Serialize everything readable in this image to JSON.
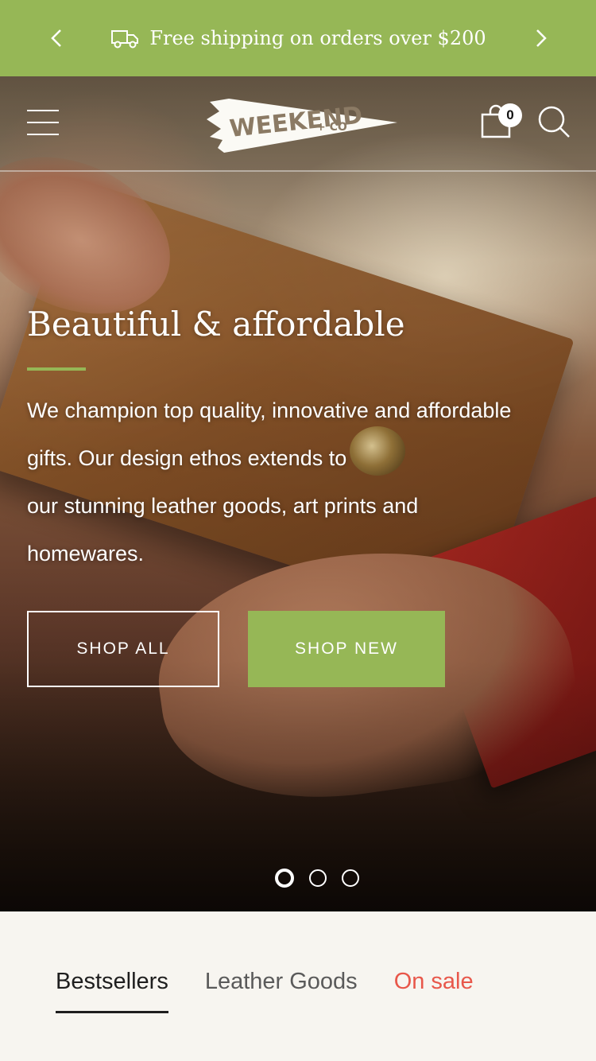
{
  "announcement": {
    "message": "Free shipping on orders over $200",
    "icons": {
      "prev": "chevron-left-icon",
      "next": "chevron-right-icon",
      "truck": "delivery-truck-icon"
    }
  },
  "header": {
    "logo_text": "WEEKEND",
    "logo_suffix": "+ CO",
    "cart_count": "0",
    "icons": {
      "menu": "hamburger-menu-icon",
      "cart": "shopping-bag-icon",
      "search": "search-icon"
    }
  },
  "hero": {
    "title": "Beautiful & affordable",
    "description": "We champion top quality, innovative and affordable gifts. Our design ethos extends to our stunning leather goods, art prints and homewares.",
    "description_lines": [
      "We champion top quality, innovative and affordable",
      "gifts. Our design ethos extends to",
      "our stunning leather goods, art prints and",
      "homewares."
    ],
    "buttons": {
      "shop_all": "SHOP ALL",
      "shop_new": "SHOP NEW"
    },
    "slides": {
      "count": 3,
      "active_index": 0
    }
  },
  "collection_tabs": {
    "items": [
      {
        "label": "Bestsellers",
        "active": true
      },
      {
        "label": "Leather Goods",
        "active": false
      },
      {
        "label": "On sale",
        "active": false
      }
    ]
  },
  "colors": {
    "brand_green": "#96b756",
    "sale_red": "#e8574a",
    "page_background": "#f7f5f0",
    "text_dark": "#1e1e1e"
  }
}
